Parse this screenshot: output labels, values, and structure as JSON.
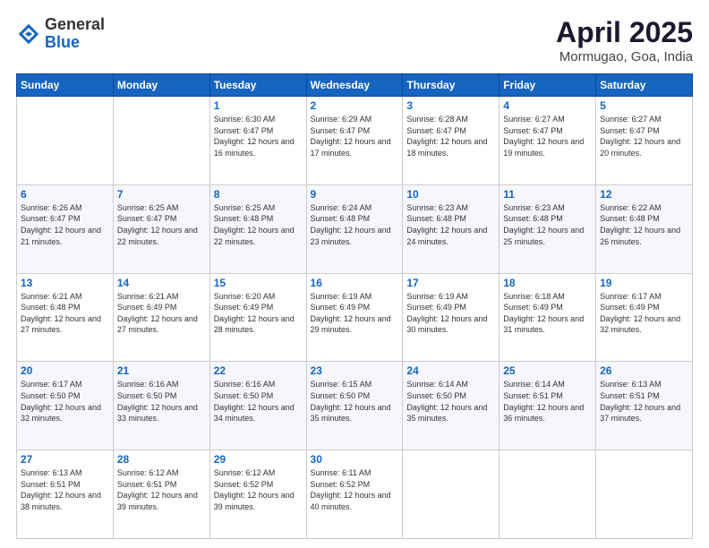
{
  "logo": {
    "general": "General",
    "blue": "Blue"
  },
  "title": {
    "month": "April 2025",
    "location": "Mormugao, Goa, India"
  },
  "headers": [
    "Sunday",
    "Monday",
    "Tuesday",
    "Wednesday",
    "Thursday",
    "Friday",
    "Saturday"
  ],
  "weeks": [
    [
      {
        "day": "",
        "sunrise": "",
        "sunset": "",
        "daylight": ""
      },
      {
        "day": "",
        "sunrise": "",
        "sunset": "",
        "daylight": ""
      },
      {
        "day": "1",
        "sunrise": "Sunrise: 6:30 AM",
        "sunset": "Sunset: 6:47 PM",
        "daylight": "Daylight: 12 hours and 16 minutes."
      },
      {
        "day": "2",
        "sunrise": "Sunrise: 6:29 AM",
        "sunset": "Sunset: 6:47 PM",
        "daylight": "Daylight: 12 hours and 17 minutes."
      },
      {
        "day": "3",
        "sunrise": "Sunrise: 6:28 AM",
        "sunset": "Sunset: 6:47 PM",
        "daylight": "Daylight: 12 hours and 18 minutes."
      },
      {
        "day": "4",
        "sunrise": "Sunrise: 6:27 AM",
        "sunset": "Sunset: 6:47 PM",
        "daylight": "Daylight: 12 hours and 19 minutes."
      },
      {
        "day": "5",
        "sunrise": "Sunrise: 6:27 AM",
        "sunset": "Sunset: 6:47 PM",
        "daylight": "Daylight: 12 hours and 20 minutes."
      }
    ],
    [
      {
        "day": "6",
        "sunrise": "Sunrise: 6:26 AM",
        "sunset": "Sunset: 6:47 PM",
        "daylight": "Daylight: 12 hours and 21 minutes."
      },
      {
        "day": "7",
        "sunrise": "Sunrise: 6:25 AM",
        "sunset": "Sunset: 6:47 PM",
        "daylight": "Daylight: 12 hours and 22 minutes."
      },
      {
        "day": "8",
        "sunrise": "Sunrise: 6:25 AM",
        "sunset": "Sunset: 6:48 PM",
        "daylight": "Daylight: 12 hours and 22 minutes."
      },
      {
        "day": "9",
        "sunrise": "Sunrise: 6:24 AM",
        "sunset": "Sunset: 6:48 PM",
        "daylight": "Daylight: 12 hours and 23 minutes."
      },
      {
        "day": "10",
        "sunrise": "Sunrise: 6:23 AM",
        "sunset": "Sunset: 6:48 PM",
        "daylight": "Daylight: 12 hours and 24 minutes."
      },
      {
        "day": "11",
        "sunrise": "Sunrise: 6:23 AM",
        "sunset": "Sunset: 6:48 PM",
        "daylight": "Daylight: 12 hours and 25 minutes."
      },
      {
        "day": "12",
        "sunrise": "Sunrise: 6:22 AM",
        "sunset": "Sunset: 6:48 PM",
        "daylight": "Daylight: 12 hours and 26 minutes."
      }
    ],
    [
      {
        "day": "13",
        "sunrise": "Sunrise: 6:21 AM",
        "sunset": "Sunset: 6:48 PM",
        "daylight": "Daylight: 12 hours and 27 minutes."
      },
      {
        "day": "14",
        "sunrise": "Sunrise: 6:21 AM",
        "sunset": "Sunset: 6:49 PM",
        "daylight": "Daylight: 12 hours and 27 minutes."
      },
      {
        "day": "15",
        "sunrise": "Sunrise: 6:20 AM",
        "sunset": "Sunset: 6:49 PM",
        "daylight": "Daylight: 12 hours and 28 minutes."
      },
      {
        "day": "16",
        "sunrise": "Sunrise: 6:19 AM",
        "sunset": "Sunset: 6:49 PM",
        "daylight": "Daylight: 12 hours and 29 minutes."
      },
      {
        "day": "17",
        "sunrise": "Sunrise: 6:19 AM",
        "sunset": "Sunset: 6:49 PM",
        "daylight": "Daylight: 12 hours and 30 minutes."
      },
      {
        "day": "18",
        "sunrise": "Sunrise: 6:18 AM",
        "sunset": "Sunset: 6:49 PM",
        "daylight": "Daylight: 12 hours and 31 minutes."
      },
      {
        "day": "19",
        "sunrise": "Sunrise: 6:17 AM",
        "sunset": "Sunset: 6:49 PM",
        "daylight": "Daylight: 12 hours and 32 minutes."
      }
    ],
    [
      {
        "day": "20",
        "sunrise": "Sunrise: 6:17 AM",
        "sunset": "Sunset: 6:50 PM",
        "daylight": "Daylight: 12 hours and 32 minutes."
      },
      {
        "day": "21",
        "sunrise": "Sunrise: 6:16 AM",
        "sunset": "Sunset: 6:50 PM",
        "daylight": "Daylight: 12 hours and 33 minutes."
      },
      {
        "day": "22",
        "sunrise": "Sunrise: 6:16 AM",
        "sunset": "Sunset: 6:50 PM",
        "daylight": "Daylight: 12 hours and 34 minutes."
      },
      {
        "day": "23",
        "sunrise": "Sunrise: 6:15 AM",
        "sunset": "Sunset: 6:50 PM",
        "daylight": "Daylight: 12 hours and 35 minutes."
      },
      {
        "day": "24",
        "sunrise": "Sunrise: 6:14 AM",
        "sunset": "Sunset: 6:50 PM",
        "daylight": "Daylight: 12 hours and 35 minutes."
      },
      {
        "day": "25",
        "sunrise": "Sunrise: 6:14 AM",
        "sunset": "Sunset: 6:51 PM",
        "daylight": "Daylight: 12 hours and 36 minutes."
      },
      {
        "day": "26",
        "sunrise": "Sunrise: 6:13 AM",
        "sunset": "Sunset: 6:51 PM",
        "daylight": "Daylight: 12 hours and 37 minutes."
      }
    ],
    [
      {
        "day": "27",
        "sunrise": "Sunrise: 6:13 AM",
        "sunset": "Sunset: 6:51 PM",
        "daylight": "Daylight: 12 hours and 38 minutes."
      },
      {
        "day": "28",
        "sunrise": "Sunrise: 6:12 AM",
        "sunset": "Sunset: 6:51 PM",
        "daylight": "Daylight: 12 hours and 39 minutes."
      },
      {
        "day": "29",
        "sunrise": "Sunrise: 6:12 AM",
        "sunset": "Sunset: 6:52 PM",
        "daylight": "Daylight: 12 hours and 39 minutes."
      },
      {
        "day": "30",
        "sunrise": "Sunrise: 6:11 AM",
        "sunset": "Sunset: 6:52 PM",
        "daylight": "Daylight: 12 hours and 40 minutes."
      },
      {
        "day": "",
        "sunrise": "",
        "sunset": "",
        "daylight": ""
      },
      {
        "day": "",
        "sunrise": "",
        "sunset": "",
        "daylight": ""
      },
      {
        "day": "",
        "sunrise": "",
        "sunset": "",
        "daylight": ""
      }
    ]
  ]
}
